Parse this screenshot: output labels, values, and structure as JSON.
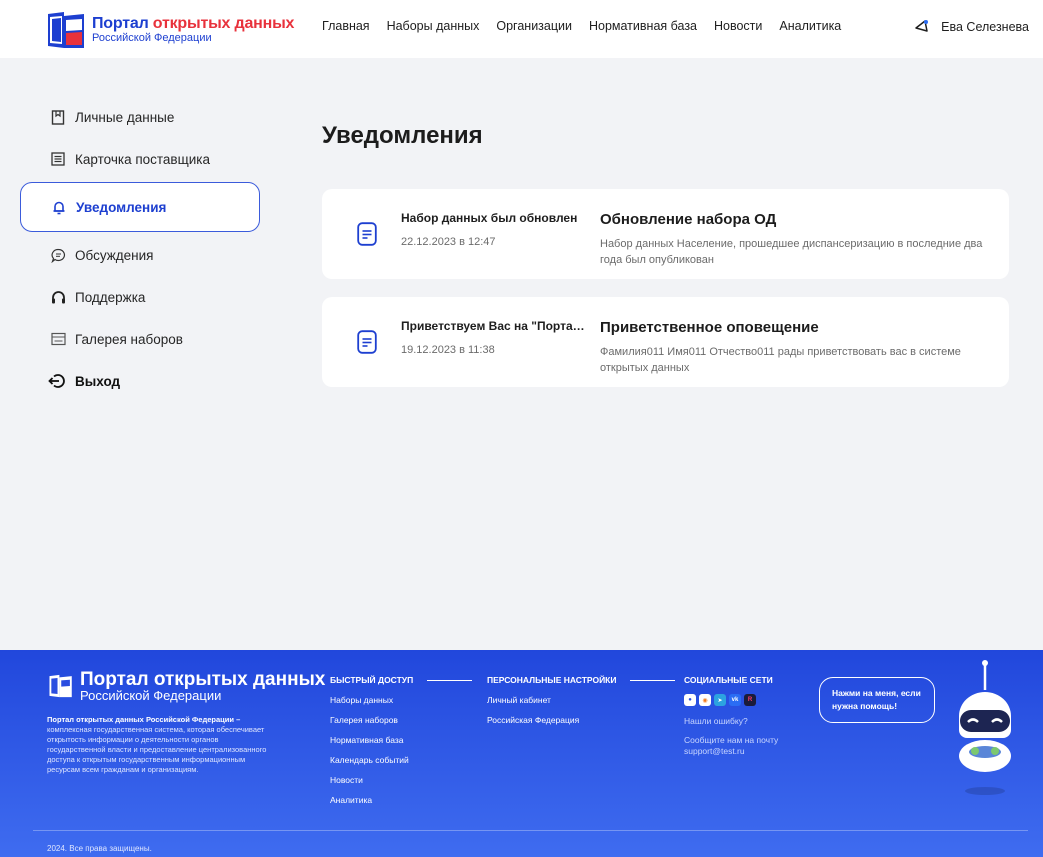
{
  "header": {
    "logo_title_part1": "Портал ",
    "logo_title_part2": "открытых данных",
    "logo_subtitle": "Российской Федерации",
    "nav": [
      "Главная",
      "Наборы данных",
      "Организации",
      "Нормативная база",
      "Новости",
      "Аналитика"
    ],
    "user_name": "Ева Селезнева"
  },
  "sidebar": {
    "items": [
      {
        "label": "Личные данные",
        "icon": "bookmark-icon"
      },
      {
        "label": "Карточка поставщика",
        "icon": "card-icon"
      },
      {
        "label": "Уведомления",
        "icon": "bell-icon",
        "active": true
      },
      {
        "label": "Обсуждения",
        "icon": "chat-icon"
      },
      {
        "label": "Поддержка",
        "icon": "headphones-icon"
      },
      {
        "label": "Галерея наборов",
        "icon": "gallery-icon"
      }
    ],
    "exit_label": "Выход"
  },
  "page": {
    "title": "Уведомления",
    "notifications": [
      {
        "title": "Набор данных был обновлен",
        "date": "22.12.2023 в 12:47",
        "heading": "Обновление набора ОД",
        "body": "Набор данных Население, прошедшее диспансеризацию в последние два года был опубликован"
      },
      {
        "title": "Приветствуем Вас на \"Портале открытых данных\"",
        "date": "19.12.2023 в 11:38",
        "heading": "Приветственное оповещение",
        "body": "Фамилия011 Имя011 Отчество011 рады приветствовать вас в системе открытых данных"
      }
    ]
  },
  "footer": {
    "logo_title": "Портал открытых данных",
    "logo_subtitle": "Российской Федерации",
    "desc_bold": "Портал открытых данных Российской Федерации –",
    "desc_rest": " комплексная государственная система, которая обеспечивает открытость информации о деятельности органов государственной власти и предоставление централизованного доступа к открытым государственным информационным ресурсам всем гражданам и организациям.",
    "quick_access": {
      "title": "БЫСТРЫЙ ДОСТУП",
      "links": [
        "Наборы данных",
        "Галерея наборов",
        "Нормативная база",
        "Календарь событий",
        "Новости",
        "Аналитика"
      ]
    },
    "personal": {
      "title": "ПЕРСОНАЛЬНЫЕ НАСТРОЙКИ",
      "links": [
        "Личный кабинет",
        "Российская Федерация"
      ]
    },
    "social": {
      "title": "СОЦИАЛЬНЫЕ СЕТИ",
      "found_error": "Нашли ошибку?",
      "mail_text": "Сообщите нам на почту",
      "email": "support@test.ru"
    },
    "helper_bubble": "Нажми на меня, если нужна помощь!",
    "copyright": "2024. Все права защищены."
  },
  "colors": {
    "brand": "#1d3fd0",
    "accent_red": "#e8323c",
    "footer_bg": "#2147dc",
    "main_bg": "#f2f3f6"
  }
}
